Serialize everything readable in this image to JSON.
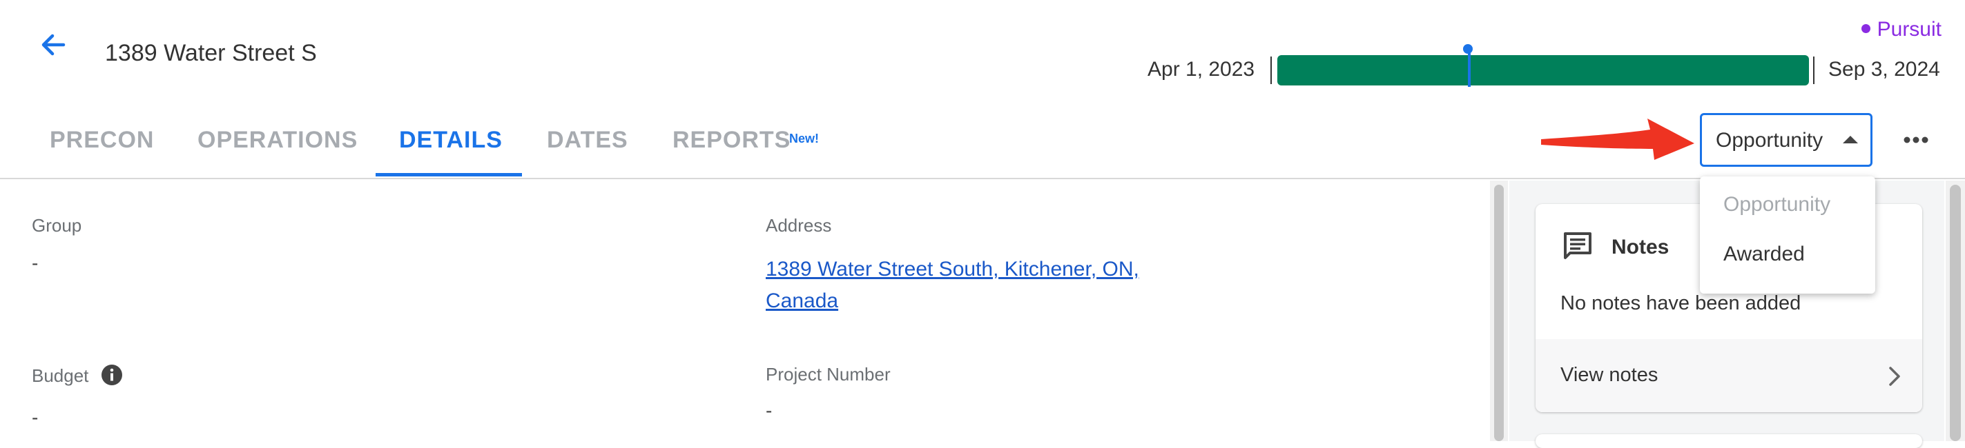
{
  "header": {
    "title": "1389 Water Street S",
    "back_icon": "arrow-left-icon",
    "status": "Pursuit",
    "status_color": "#8a2be2",
    "timeline": {
      "start_label": "Apr 1, 2023",
      "end_label": "Sep 3, 2024",
      "bar_color": "#00805a",
      "marker_color": "#1a73e8"
    }
  },
  "tabs": [
    {
      "label": "PRECON",
      "active": false
    },
    {
      "label": "OPERATIONS",
      "active": false
    },
    {
      "label": "DETAILS",
      "active": true
    },
    {
      "label": "DATES",
      "active": false
    },
    {
      "label": "REPORTS",
      "active": false,
      "badge": "New!"
    }
  ],
  "accent_color": "#1a73e8",
  "phase_select": {
    "value": "Opportunity",
    "options": [
      {
        "label": "Opportunity",
        "disabled": true
      },
      {
        "label": "Awarded",
        "disabled": false
      }
    ]
  },
  "annotation": {
    "arrow_color": "#ee3322",
    "icon": "red-arrow-icon"
  },
  "details": {
    "group": {
      "label": "Group",
      "value": "-"
    },
    "address": {
      "label": "Address",
      "value": "1389 Water Street South, Kitchener, ON, Canada"
    },
    "budget": {
      "label": "Budget",
      "value": "-",
      "info_icon": "info-icon"
    },
    "project_number": {
      "label": "Project Number",
      "value": "-"
    }
  },
  "notes": {
    "title": "Notes",
    "icon": "notes-icon",
    "empty_text": "No notes have been added",
    "view_label": "View notes",
    "chevron_icon": "chevron-right-icon"
  },
  "more_icon": "more-horizontal-icon"
}
